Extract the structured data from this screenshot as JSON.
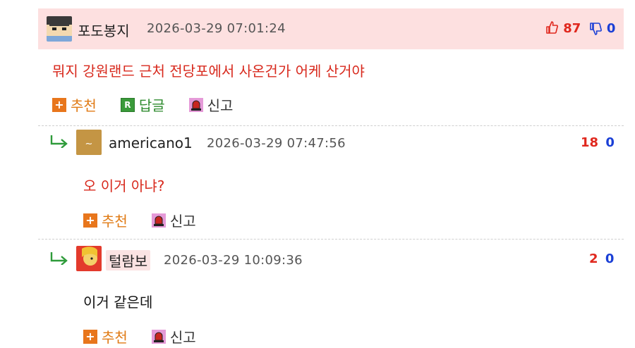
{
  "post": {
    "nickname": "포도봉지",
    "timestamp": "2026-03-29 07:01:24",
    "upvotes": "87",
    "downvotes": "0",
    "body": "뭐지 강원랜드 근처 전당포에서 사온건가 어케 산거야",
    "actions": {
      "recommend": "추천",
      "reply": "답글",
      "report": "신고"
    },
    "icons": {
      "recommend": "plus-icon",
      "reply": "reply-icon",
      "report": "siren-icon",
      "up": "thumbs-up-icon",
      "down": "thumbs-down-icon"
    }
  },
  "replies": [
    {
      "nickname": "americano1",
      "timestamp": "2026-03-29 07:47:56",
      "upvotes": "18",
      "downvotes": "0",
      "body": "오 이거 아냐?",
      "actions": {
        "recommend": "추천",
        "report": "신고"
      }
    },
    {
      "nickname": "털람보",
      "timestamp": "2026-03-29 10:09:36",
      "upvotes": "2",
      "downvotes": "0",
      "body": "이거 같은데",
      "actions": {
        "recommend": "추천",
        "report": "신고"
      }
    }
  ],
  "colors": {
    "accent_red": "#e0281e",
    "accent_blue": "#1a3fd6",
    "header_bg": "#fde0e0",
    "action_orange": "#e8761c",
    "action_green": "#3a9a3a"
  }
}
